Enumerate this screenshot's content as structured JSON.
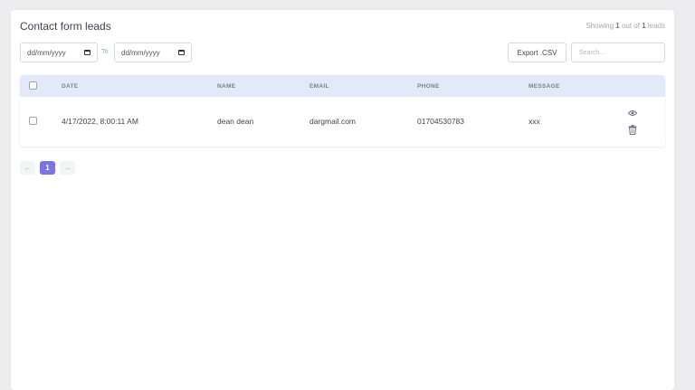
{
  "header": {
    "title": "Contact form leads",
    "showing_prefix": "Showing ",
    "showing_count": "1",
    "showing_mid": " out of ",
    "showing_total": "1",
    "showing_suffix": " leads"
  },
  "filters": {
    "date_from_placeholder": "dd/mm/yyyy",
    "to_label": "To",
    "date_to_placeholder": "dd/mm/yyyy",
    "export_label": "Export .CSV",
    "search_placeholder": "Search..."
  },
  "table": {
    "columns": [
      "DATE",
      "NAME",
      "EMAIL",
      "PHONE",
      "MESSAGE"
    ],
    "rows": [
      {
        "date": "4/17/2022, 8:00:11 AM",
        "name": "dean dean",
        "email": "dargmail.com",
        "phone": "01704530783",
        "message": "xxx"
      }
    ]
  },
  "pagination": {
    "prev": "←",
    "current_page": "1",
    "next": "→"
  },
  "colors": {
    "accent": "#7b73e3",
    "header_bg": "#e4e9fa"
  },
  "icons": [
    "calendar-icon",
    "eye-icon",
    "trash-icon",
    "arrow-left-icon",
    "arrow-right-icon"
  ]
}
